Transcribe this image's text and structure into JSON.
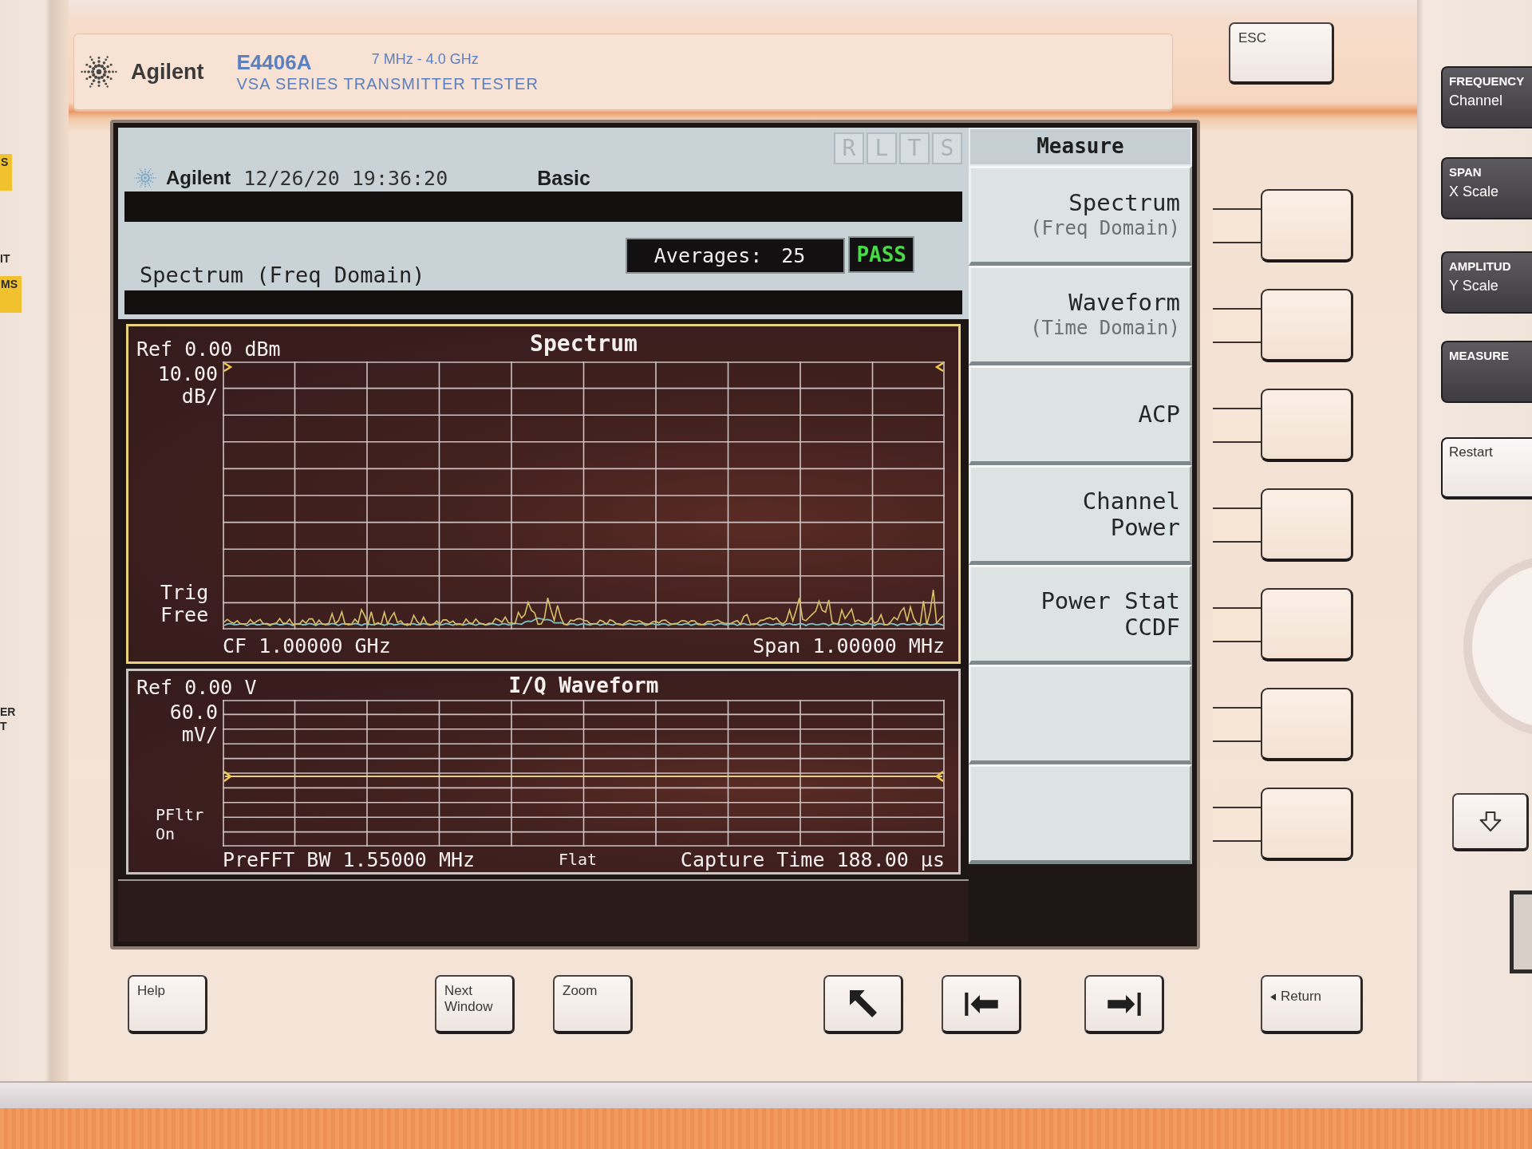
{
  "side_panel": {
    "labels": [
      {
        "text": "S",
        "kind": "tag"
      },
      {
        "text": "IT",
        "kind": "plain"
      },
      {
        "text": "MS",
        "kind": "tag"
      },
      {
        "text": "ER",
        "kind": "plain"
      },
      {
        "text": "T",
        "kind": "plain"
      }
    ]
  },
  "nameplate": {
    "brand": "Agilent",
    "model": "E4406A",
    "range": "7 MHz - 4.0 GHz",
    "series": "VSA SERIES TRANSMITTER TESTER"
  },
  "esc_key": "ESC",
  "screen": {
    "header": {
      "brand": "Agilent",
      "datetime": "12/26/20 19:36:20",
      "mode": "Basic",
      "indicators": [
        {
          "label": "R",
          "on": false
        },
        {
          "label": "L",
          "on": false
        },
        {
          "label": "T",
          "on": false
        },
        {
          "label": "S",
          "on": false
        }
      ]
    },
    "measurement": "Spectrum (Freq Domain)",
    "averages": {
      "label": "Averages:",
      "value": "25"
    },
    "result": {
      "text": "PASS",
      "passed": true
    },
    "spectrum": {
      "selected": true,
      "title": "Spectrum",
      "ref_level": "Ref 0.00 dBm",
      "scale": "10.00\ndB/",
      "trigger": "Trig\nFree",
      "center": "CF 1.00000 GHz",
      "span": "Span 1.00000 MHz"
    },
    "iq_waveform": {
      "selected": false,
      "title": "I/Q Waveform",
      "ref_level": "Ref 0.00 V",
      "scale": "60.0\nmV/",
      "filter": "PFltr\nOn",
      "bandwidth": "PreFFT BW 1.55000 MHz",
      "window": "Flat",
      "capture_time": "Capture Time 188.00 μs"
    },
    "menu": {
      "title": "Measure",
      "softkeys": [
        {
          "kind": "label",
          "label": "Spectrum",
          "sublabel": "(Freq Domain)"
        },
        {
          "kind": "label",
          "label": "Waveform",
          "sublabel": "(Time Domain)"
        },
        {
          "kind": "label",
          "label": "ACP"
        },
        {
          "kind": "label",
          "label": "Channel\nPower"
        },
        {
          "kind": "label",
          "label": "Power Stat\nCCDF"
        },
        {
          "kind": "blank"
        },
        {
          "kind": "blank"
        }
      ]
    }
  },
  "bottom_keys": [
    {
      "kind": "label",
      "label": "Help"
    },
    {
      "kind": "label",
      "label": "Next\nWindow"
    },
    {
      "kind": "label",
      "label": "Zoom"
    },
    {
      "kind": "home"
    },
    {
      "kind": "back_tab"
    },
    {
      "kind": "tab"
    },
    {
      "kind": "return",
      "label": "Return"
    }
  ],
  "right_keys": [
    {
      "kind": "menu",
      "title": "FREQUENCY",
      "subtitle": "Channel"
    },
    {
      "kind": "menu",
      "title": "SPAN",
      "subtitle": "X Scale"
    },
    {
      "kind": "menu",
      "title": "AMPLITUD",
      "subtitle": "Y Scale"
    },
    {
      "kind": "menu",
      "title": "MEASURE"
    },
    {
      "kind": "plain",
      "title": "Restart"
    }
  ]
}
